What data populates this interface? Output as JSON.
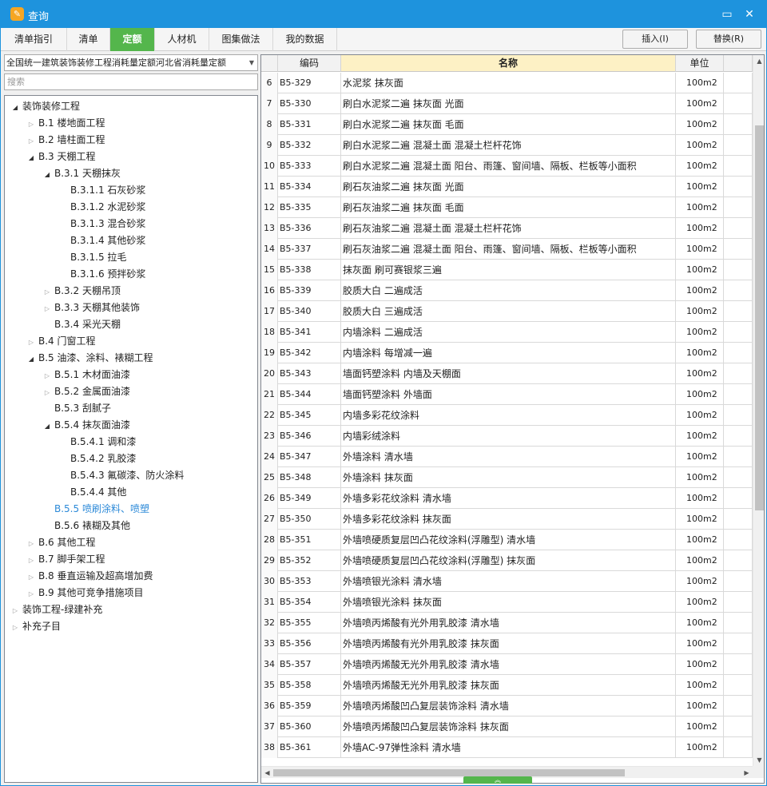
{
  "window": {
    "title": "查询"
  },
  "tabs": [
    {
      "label": "清单指引",
      "active": false
    },
    {
      "label": "清单",
      "active": false
    },
    {
      "label": "定额",
      "active": true
    },
    {
      "label": "人材机",
      "active": false
    },
    {
      "label": "图集做法",
      "active": false
    },
    {
      "label": "我的数据",
      "active": false
    }
  ],
  "actions": {
    "insert_label": "插入(I)",
    "replace_label": "替换(R)"
  },
  "library": {
    "selected": "全国统一建筑装饰装修工程消耗量定额河北省消耗量定额"
  },
  "search": {
    "placeholder": "搜索"
  },
  "tree": [
    {
      "label": "装饰装修工程",
      "level": 0,
      "state": "open"
    },
    {
      "label": "B.1 楼地面工程",
      "level": 1,
      "state": "closed"
    },
    {
      "label": "B.2 墙柱面工程",
      "level": 1,
      "state": "closed"
    },
    {
      "label": "B.3 天棚工程",
      "level": 1,
      "state": "open"
    },
    {
      "label": "B.3.1 天棚抹灰",
      "level": 2,
      "state": "open"
    },
    {
      "label": "B.3.1.1 石灰砂浆",
      "level": 3,
      "state": "leaf"
    },
    {
      "label": "B.3.1.2 水泥砂浆",
      "level": 3,
      "state": "leaf"
    },
    {
      "label": "B.3.1.3 混合砂浆",
      "level": 3,
      "state": "leaf"
    },
    {
      "label": "B.3.1.4 其他砂浆",
      "level": 3,
      "state": "leaf"
    },
    {
      "label": "B.3.1.5 拉毛",
      "level": 3,
      "state": "leaf"
    },
    {
      "label": "B.3.1.6 预拌砂浆",
      "level": 3,
      "state": "leaf"
    },
    {
      "label": "B.3.2 天棚吊顶",
      "level": 2,
      "state": "closed"
    },
    {
      "label": "B.3.3 天棚其他装饰",
      "level": 2,
      "state": "closed"
    },
    {
      "label": "B.3.4 采光天棚",
      "level": 2,
      "state": "leaf"
    },
    {
      "label": "B.4 门窗工程",
      "level": 1,
      "state": "closed"
    },
    {
      "label": "B.5 油漆、涂料、裱糊工程",
      "level": 1,
      "state": "open"
    },
    {
      "label": "B.5.1 木材面油漆",
      "level": 2,
      "state": "closed"
    },
    {
      "label": "B.5.2 金属面油漆",
      "level": 2,
      "state": "closed"
    },
    {
      "label": "B.5.3 刮腻子",
      "level": 2,
      "state": "leaf"
    },
    {
      "label": "B.5.4 抹灰面油漆",
      "level": 2,
      "state": "open"
    },
    {
      "label": "B.5.4.1 调和漆",
      "level": 3,
      "state": "leaf"
    },
    {
      "label": "B.5.4.2 乳胶漆",
      "level": 3,
      "state": "leaf"
    },
    {
      "label": "B.5.4.3 氟碳漆、防火涂料",
      "level": 3,
      "state": "leaf"
    },
    {
      "label": "B.5.4.4 其他",
      "level": 3,
      "state": "leaf"
    },
    {
      "label": "B.5.5 喷刷涂料、喷塑",
      "level": 2,
      "state": "leaf",
      "selected": true
    },
    {
      "label": "B.5.6 裱糊及其他",
      "level": 2,
      "state": "leaf"
    },
    {
      "label": "B.6 其他工程",
      "level": 1,
      "state": "closed"
    },
    {
      "label": "B.7 脚手架工程",
      "level": 1,
      "state": "closed"
    },
    {
      "label": "B.8 垂直运输及超高增加费",
      "level": 1,
      "state": "closed"
    },
    {
      "label": "B.9 其他可竞争措施项目",
      "level": 1,
      "state": "closed"
    },
    {
      "label": "装饰工程-绿建补充",
      "level": 0,
      "state": "closed"
    },
    {
      "label": "补充子目",
      "level": 0,
      "state": "closed"
    }
  ],
  "table": {
    "headers": {
      "code": "编码",
      "name": "名称",
      "unit": "单位"
    },
    "rows": [
      {
        "no": "6",
        "code": "B5-329",
        "name": "水泥浆 抹灰面",
        "unit": "100m2"
      },
      {
        "no": "7",
        "code": "B5-330",
        "name": "刷白水泥浆二遍 抹灰面 光面",
        "unit": "100m2"
      },
      {
        "no": "8",
        "code": "B5-331",
        "name": "刷白水泥浆二遍 抹灰面 毛面",
        "unit": "100m2"
      },
      {
        "no": "9",
        "code": "B5-332",
        "name": "刷白水泥浆二遍 混凝土面 混凝土栏杆花饰",
        "unit": "100m2"
      },
      {
        "no": "10",
        "code": "B5-333",
        "name": "刷白水泥浆二遍 混凝土面 阳台、雨篷、窗间墙、隔板、栏板等小面积",
        "unit": "100m2"
      },
      {
        "no": "11",
        "code": "B5-334",
        "name": "刷石灰油浆二遍 抹灰面 光面",
        "unit": "100m2"
      },
      {
        "no": "12",
        "code": "B5-335",
        "name": "刷石灰油浆二遍 抹灰面 毛面",
        "unit": "100m2"
      },
      {
        "no": "13",
        "code": "B5-336",
        "name": "刷石灰油浆二遍 混凝土面 混凝土栏杆花饰",
        "unit": "100m2"
      },
      {
        "no": "14",
        "code": "B5-337",
        "name": "刷石灰油浆二遍 混凝土面 阳台、雨篷、窗间墙、隔板、栏板等小面积",
        "unit": "100m2"
      },
      {
        "no": "15",
        "code": "B5-338",
        "name": "抹灰面 刷可赛银浆三遍",
        "unit": "100m2"
      },
      {
        "no": "16",
        "code": "B5-339",
        "name": "胶质大白 二遍成活",
        "unit": "100m2"
      },
      {
        "no": "17",
        "code": "B5-340",
        "name": "胶质大白 三遍成活",
        "unit": "100m2"
      },
      {
        "no": "18",
        "code": "B5-341",
        "name": "内墙涂料 二遍成活",
        "unit": "100m2"
      },
      {
        "no": "19",
        "code": "B5-342",
        "name": "内墙涂料 每增减一遍",
        "unit": "100m2"
      },
      {
        "no": "20",
        "code": "B5-343",
        "name": "墙面钙塑涂料 内墙及天棚面",
        "unit": "100m2"
      },
      {
        "no": "21",
        "code": "B5-344",
        "name": "墙面钙塑涂料 外墙面",
        "unit": "100m2"
      },
      {
        "no": "22",
        "code": "B5-345",
        "name": "内墙多彩花纹涂料",
        "unit": "100m2"
      },
      {
        "no": "23",
        "code": "B5-346",
        "name": "内墙彩绒涂料",
        "unit": "100m2"
      },
      {
        "no": "24",
        "code": "B5-347",
        "name": "外墙涂料 清水墙",
        "unit": "100m2"
      },
      {
        "no": "25",
        "code": "B5-348",
        "name": "外墙涂料 抹灰面",
        "unit": "100m2"
      },
      {
        "no": "26",
        "code": "B5-349",
        "name": "外墙多彩花纹涂料 清水墙",
        "unit": "100m2"
      },
      {
        "no": "27",
        "code": "B5-350",
        "name": "外墙多彩花纹涂料 抹灰面",
        "unit": "100m2"
      },
      {
        "no": "28",
        "code": "B5-351",
        "name": "外墙喷硬质复层凹凸花纹涂料(浮雕型) 清水墙",
        "unit": "100m2"
      },
      {
        "no": "29",
        "code": "B5-352",
        "name": "外墙喷硬质复层凹凸花纹涂料(浮雕型) 抹灰面",
        "unit": "100m2"
      },
      {
        "no": "30",
        "code": "B5-353",
        "name": "外墙喷银光涂料 清水墙",
        "unit": "100m2"
      },
      {
        "no": "31",
        "code": "B5-354",
        "name": "外墙喷银光涂料 抹灰面",
        "unit": "100m2"
      },
      {
        "no": "32",
        "code": "B5-355",
        "name": "外墙喷丙烯酸有光外用乳胶漆 清水墙",
        "unit": "100m2"
      },
      {
        "no": "33",
        "code": "B5-356",
        "name": "外墙喷丙烯酸有光外用乳胶漆 抹灰面",
        "unit": "100m2"
      },
      {
        "no": "34",
        "code": "B5-357",
        "name": "外墙喷丙烯酸无光外用乳胶漆 清水墙",
        "unit": "100m2"
      },
      {
        "no": "35",
        "code": "B5-358",
        "name": "外墙喷丙烯酸无光外用乳胶漆 抹灰面",
        "unit": "100m2"
      },
      {
        "no": "36",
        "code": "B5-359",
        "name": "外墙喷丙烯酸凹凸复层装饰涂料 清水墙",
        "unit": "100m2"
      },
      {
        "no": "37",
        "code": "B5-360",
        "name": "外墙喷丙烯酸凹凸复层装饰涂料 抹灰面",
        "unit": "100m2"
      },
      {
        "no": "38",
        "code": "B5-361",
        "name": "外墙AC-97弹性涂料 清水墙",
        "unit": "100m2"
      }
    ]
  },
  "colors": {
    "titlebar": "#1e93dd",
    "active_tab": "#54b64c",
    "selected_node": "#2d8ad8",
    "header_highlight": "#fdf1c5"
  }
}
